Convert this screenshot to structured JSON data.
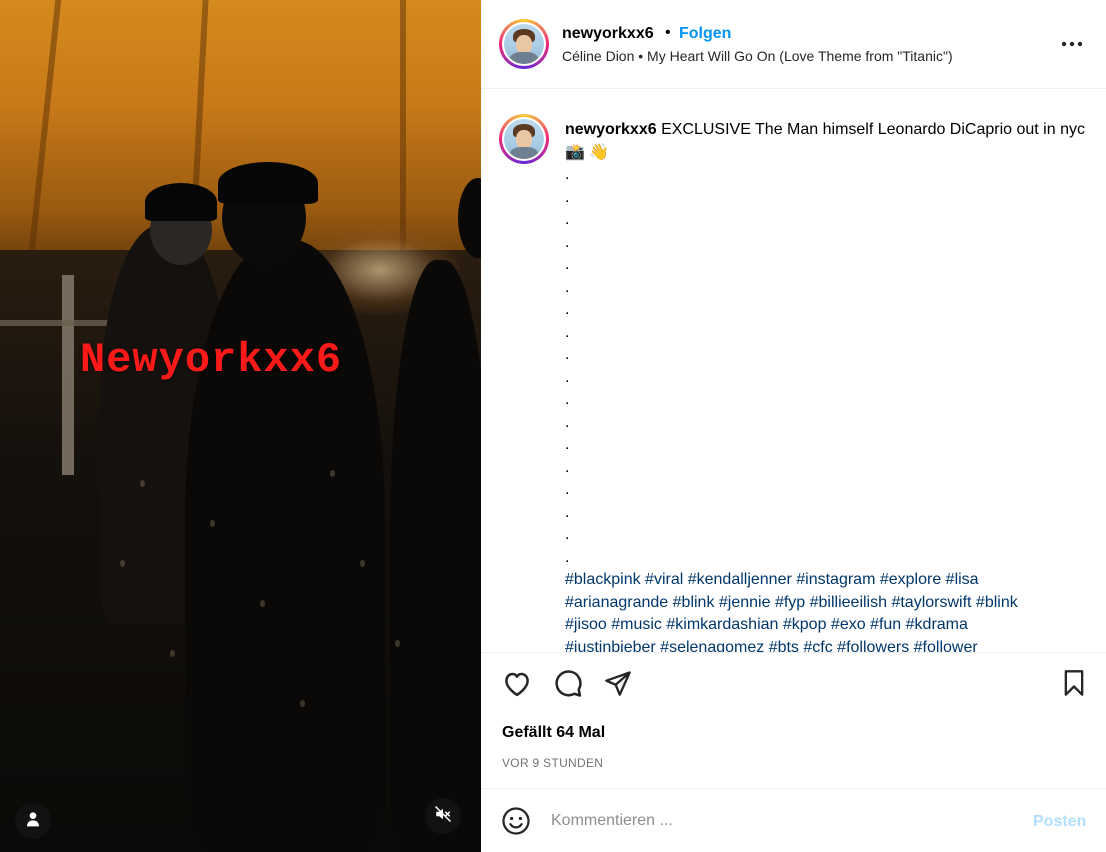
{
  "media": {
    "watermark": "Newyorkxx6"
  },
  "header": {
    "username": "newyorkxx6",
    "separator": "•",
    "follow_label": "Folgen",
    "music": "Céline Dion • My Heart Will Go On (Love Theme from \"Titanic\")"
  },
  "caption": {
    "username": "newyorkxx6",
    "text": "EXCLUSIVE The Man himself Leonardo DiCaprio out in nyc📸 👋",
    "dots": [
      ".",
      ".",
      ".",
      ".",
      ".",
      ".",
      ".",
      ".",
      ".",
      ".",
      ".",
      ".",
      ".",
      ".",
      ".",
      ".",
      ".",
      "."
    ],
    "hashtags_line1": "#blackpink #viral #kendalljenner #instagram #explore #lisa",
    "hashtags_line2": "#arianagrande #blink #jennie #fyp #billieeilish #taylorswift #blink",
    "hashtags_line3": "#jisoo #music #kimkardashian #kpop #exo #fun #kdrama",
    "hashtags_line4": "#justinbieber #selenagomez #bts #cfc #followers #follower"
  },
  "engagement": {
    "likes": "Gefällt 64 Mal",
    "time": "VOR 9 STUNDEN"
  },
  "comment": {
    "placeholder": "Kommentieren ...",
    "post_label": "Posten"
  },
  "icons": {
    "more": "more-horizontal-icon",
    "like": "heart-icon",
    "comment": "comment-icon",
    "share": "send-icon",
    "save": "bookmark-icon",
    "emoji": "emoji-icon",
    "mute": "muted-speaker-icon",
    "tagged": "user-tag-icon"
  },
  "colors": {
    "link": "#0095f6",
    "hashtag": "#00376b",
    "watermark": "#ff1a1a",
    "post_disabled": "#b2dffc"
  }
}
